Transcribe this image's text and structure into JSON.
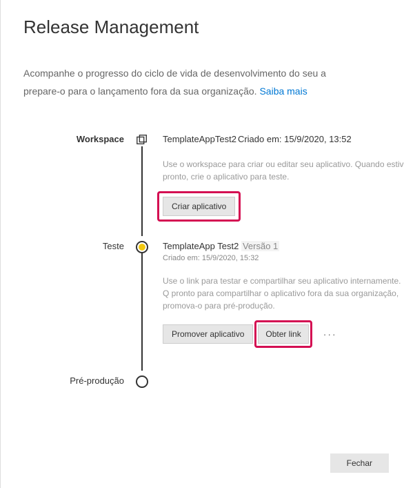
{
  "title": "Release Management",
  "intro_line1": "Acompanhe o progresso do ciclo de vida de desenvolvimento do seu a",
  "intro_line2_prefix": "prepare-o para o lançamento fora da sua organização. ",
  "intro_link": "Saiba mais",
  "stages": {
    "workspace": {
      "label": "Workspace",
      "title_prefix": "TemplateAppTest2",
      "created": "Criado em: 15/9/2020, 13:52",
      "desc": "Use o workspace para criar ou editar seu aplicativo. Quando estiv pronto, crie o aplicativo para teste.",
      "btn_create": "Criar aplicativo"
    },
    "teste": {
      "label": "Teste",
      "title_prefix": "TemplateApp Test2",
      "version": "Versão 1",
      "created": "Criado em: 15/9/2020, 15:32",
      "desc": "Use o link para testar e compartilhar seu aplicativo internamente. Q pronto para compartilhar o aplicativo fora da sua organização, promova-o para pré-produção.",
      "btn_promote": "Promover aplicativo",
      "btn_link": "Obter link",
      "more": "···"
    },
    "preprod": {
      "label": "Pré-produção"
    }
  },
  "close": "Fechar"
}
